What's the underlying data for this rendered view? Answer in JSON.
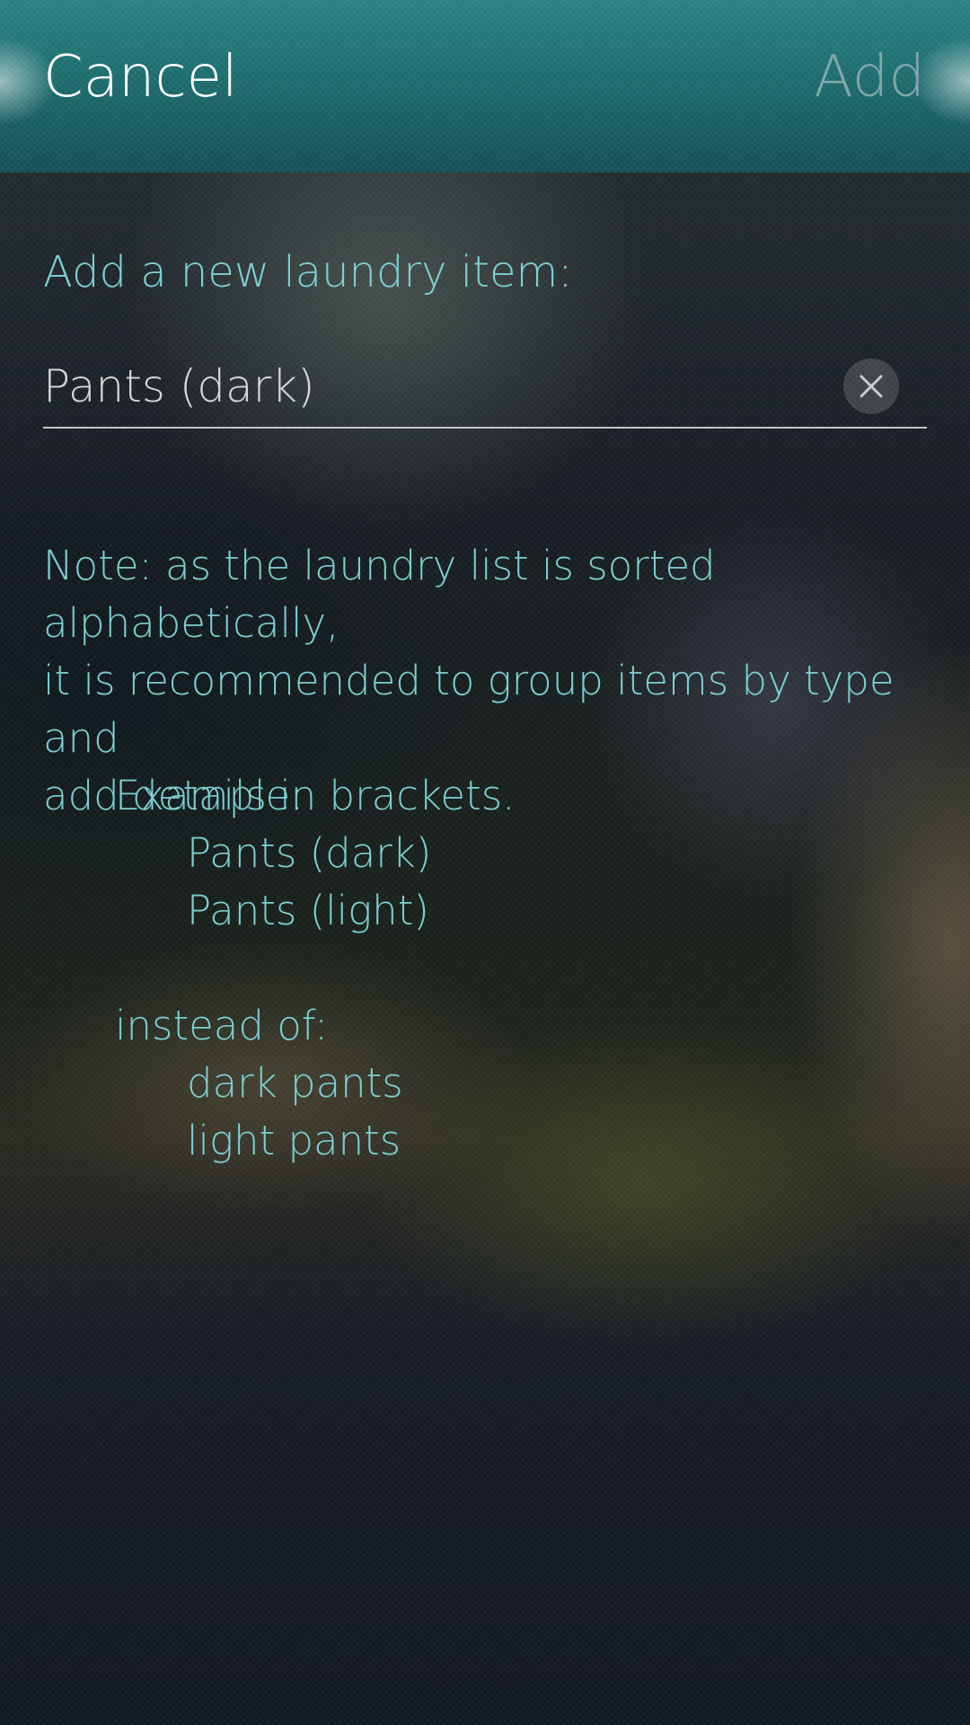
{
  "header": {
    "cancel_label": "Cancel",
    "add_label": "Add"
  },
  "form": {
    "prompt": "Add a new laundry item:",
    "input_value": "Pants (dark)",
    "clear_icon": "close-icon"
  },
  "note": {
    "text_line1": "Note: as the laundry list is sorted alphabetically,",
    "text_line2": "it is recommended to group items by type and",
    "text_line3": "add details in brackets.",
    "example_heading": "Example:",
    "examples": [
      "Pants (dark)",
      "Pants (light)"
    ],
    "instead_heading": "instead of:",
    "counter_examples": [
      "dark pants",
      "light pants"
    ]
  },
  "colors": {
    "header_teal": "#1d6c6e",
    "accent_text": "#7ccfd0",
    "disabled_action": "#7fa7a7",
    "primary_text": "#ffffff"
  }
}
